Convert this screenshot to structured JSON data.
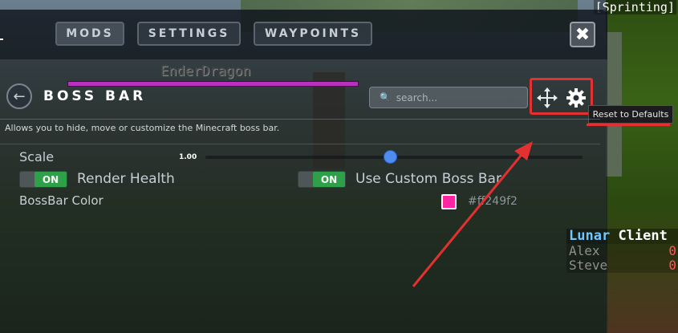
{
  "hud": {
    "sprinting": "[Sprinting]"
  },
  "nav": {
    "mods": "MODS",
    "settings": "SETTINGS",
    "waypoints": "WAYPOINTS",
    "close_icon": "close-icon"
  },
  "boss": {
    "name": "EnderDragon",
    "bar_color": "#ba2fbd"
  },
  "header": {
    "title": "BOSS BAR",
    "search_placeholder": "search..."
  },
  "actions": {
    "move_icon": "move-arrows-icon",
    "gear_icon": "gear-icon",
    "tooltip": "Reset to Defaults"
  },
  "description": "Allows you to hide, move or customize the Minecraft boss bar.",
  "settings": {
    "scale": {
      "label": "Scale",
      "value": "1.00",
      "fraction": 0.49
    },
    "render_health": {
      "label": "Render Health",
      "state": "ON"
    },
    "custom_boss_bar": {
      "label": "Use Custom Boss Bar",
      "state": "ON"
    },
    "bossbar_color": {
      "label": "BossBar Color",
      "hex": "#ff249f2",
      "color": "#ff249f"
    }
  },
  "scoreboard": {
    "title_part1": "Lunar",
    "title_part2": "Client",
    "rows": [
      {
        "name": "Alex",
        "score": "0"
      },
      {
        "name": "Steve",
        "score": "0"
      }
    ]
  },
  "colors": {
    "accent_blue": "#4f8cf0",
    "toggle_green": "#2fa04a",
    "annotation_red": "#e33030"
  }
}
